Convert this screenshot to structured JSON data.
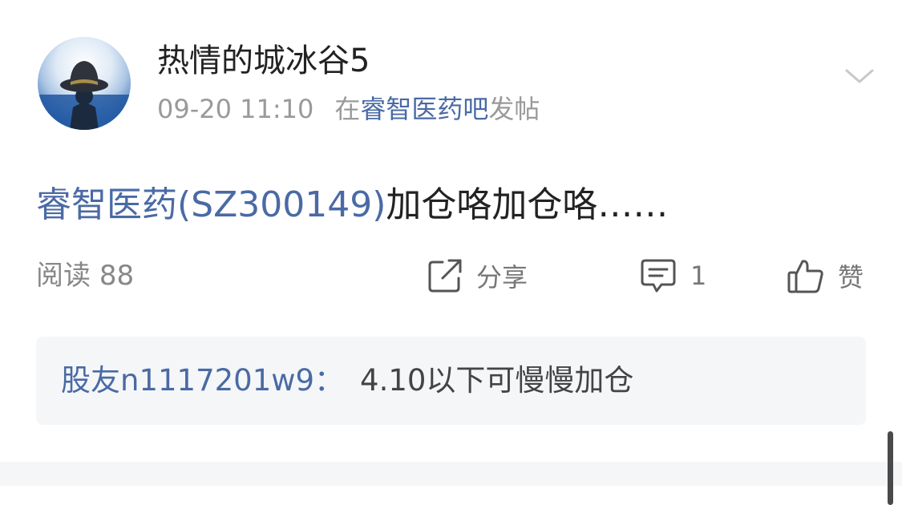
{
  "post": {
    "username": "热情的城冰谷5",
    "date": "09-20 11:10",
    "posted_in_prefix": "在",
    "bar_name": "睿智医药吧",
    "posted_in_suffix": "发帖",
    "content_stock": "睿智医药(SZ300149)",
    "content_text": "加仓咯加仓咯……"
  },
  "actions": {
    "read_label": "阅读",
    "read_count": "88",
    "share_label": "分享",
    "comment_count": "1",
    "like_label": "赞"
  },
  "reply": {
    "author": "股友n1117201w9：",
    "text": "4.10以下可慢慢加仓"
  },
  "colors": {
    "link_blue": "#4a6aa5",
    "meta_gray": "#9a9a9a",
    "reply_bg": "#f5f6f8"
  },
  "icons": [
    "chevron-down-icon",
    "share-icon",
    "comment-icon",
    "thumbs-up-icon"
  ]
}
